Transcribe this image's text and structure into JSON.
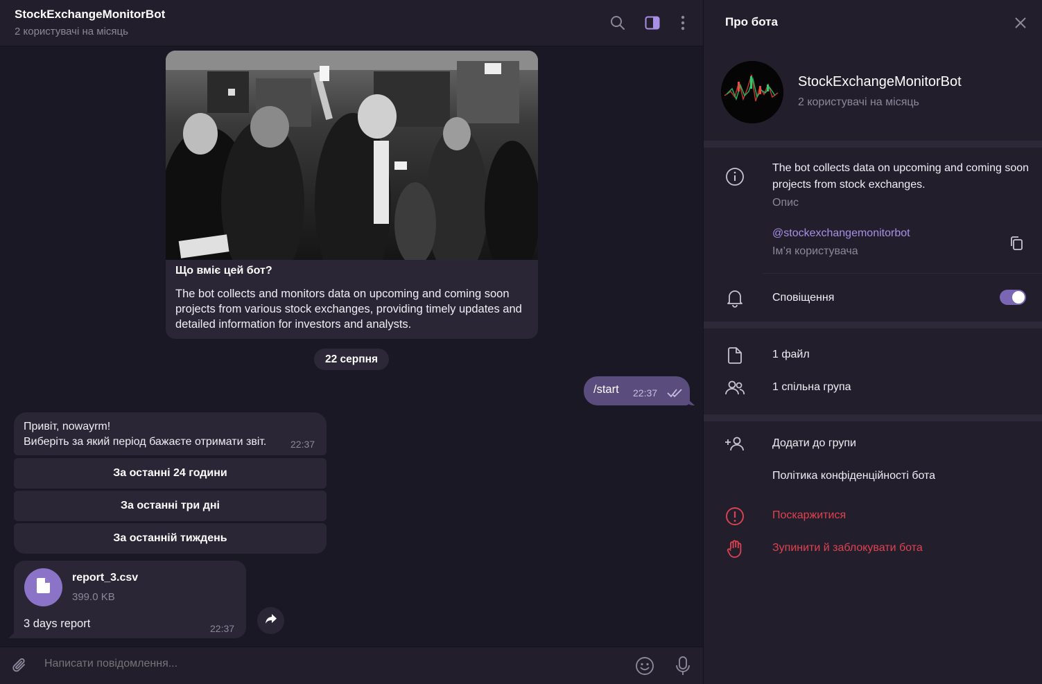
{
  "chat": {
    "title": "StockExchangeMonitorBot",
    "subtitle": "2 користувачі на місяць",
    "intro": {
      "title": "Що вміє цей бот?",
      "text": "The bot collects and monitors data on upcoming and coming soon projects from various stock exchanges, providing timely updates and detailed information for investors and analysts."
    },
    "date_label": "22 серпня",
    "outgoing": {
      "text": "/start",
      "time": "22:37"
    },
    "incoming": {
      "line1": "Привіт, nowayrm!",
      "line2": "Виберіть за який період бажаєте отримати звіт.",
      "time": "22:37"
    },
    "keyboard": [
      "За останні 24 години",
      "За останні три дні",
      "За останній тиждень"
    ],
    "file": {
      "name": "report_3.csv",
      "size": "399.0 KB",
      "caption": "3 days report",
      "time": "22:37"
    },
    "composer_placeholder": "Написати повідомлення..."
  },
  "panel": {
    "title": "Про бота",
    "bot_name": "StockExchangeMonitorBot",
    "bot_sub": "2 користувачі на місяць",
    "description": "The bot collects data on upcoming and coming soon projects from stock exchanges.",
    "description_label": "Опис",
    "username": "@stockexchangemonitorbot",
    "username_label": "Ім’я користувача",
    "notifications_label": "Сповіщення",
    "notifications_on": true,
    "files_label": "1 файл",
    "groups_label": "1 спільна група",
    "add_to_group": "Додати до групи",
    "privacy": "Політика конфіденційності бота",
    "report": "Поскаржитися",
    "block": "Зупинити й заблокувати бота"
  },
  "colors": {
    "accent": "#7a66b3",
    "link": "#a98fe6",
    "danger": "#e0424f",
    "outgoing_bubble": "#5a4c7d",
    "incoming_bubble": "#2b2636"
  }
}
